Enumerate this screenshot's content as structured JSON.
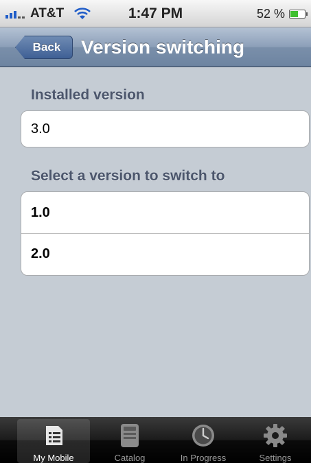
{
  "status_bar": {
    "carrier": "AT&T",
    "time": "1:47 PM",
    "battery_percent": "52 %",
    "battery_level": 0.52,
    "icons": [
      "signal-icon",
      "wifi-icon",
      "battery-icon"
    ]
  },
  "nav_bar": {
    "back_label": "Back",
    "title": "Version switching"
  },
  "installed": {
    "header": "Installed version",
    "value": "3.0"
  },
  "switch": {
    "header": "Select a version to switch to",
    "options": [
      "1.0",
      "2.0"
    ]
  },
  "tab_bar": {
    "selected": "My Mobile",
    "tabs": [
      {
        "label": "My Mobile",
        "icon": "list-icon"
      },
      {
        "label": "Catalog",
        "icon": "catalog-icon"
      },
      {
        "label": "In Progress",
        "icon": "clock-icon"
      },
      {
        "label": "Settings",
        "icon": "gear-icon"
      }
    ]
  },
  "colors": {
    "background": "#c5ccd4",
    "nav_bar": "#8c9fb8",
    "section_header": "#4c566c",
    "tab_bar": "#1b1b1b"
  }
}
